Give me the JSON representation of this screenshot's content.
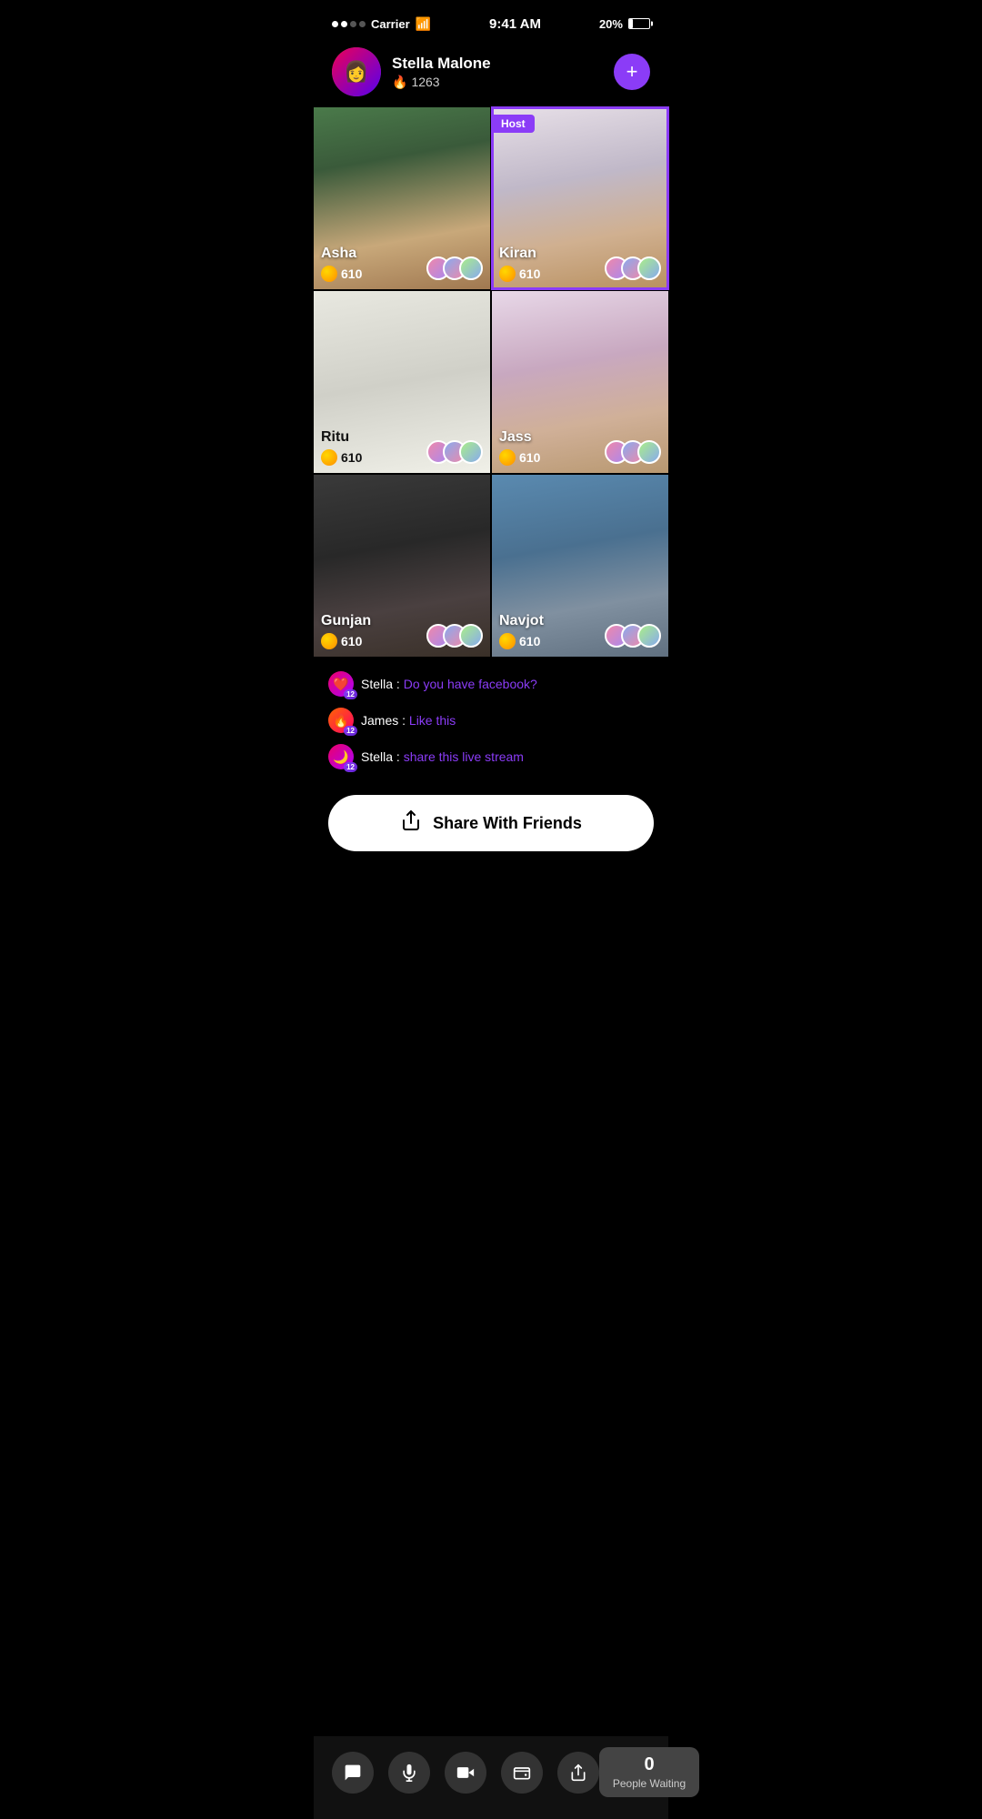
{
  "statusBar": {
    "carrier": "Carrier",
    "time": "9:41 AM",
    "battery": "20%"
  },
  "profile": {
    "name": "Stella Malone",
    "score": "1263",
    "addLabel": "+"
  },
  "grid": {
    "cells": [
      {
        "id": "asha",
        "name": "Asha",
        "coins": "610",
        "isHost": false,
        "bgClass": "bg-asha"
      },
      {
        "id": "kiran",
        "name": "Kiran",
        "coins": "610",
        "isHost": true,
        "bgClass": "bg-kiran"
      },
      {
        "id": "ritu",
        "name": "Ritu",
        "coins": "610",
        "isHost": false,
        "bgClass": "bg-ritu"
      },
      {
        "id": "jass",
        "name": "Jass",
        "coins": "610",
        "isHost": false,
        "bgClass": "bg-jass"
      },
      {
        "id": "gunjan",
        "name": "Gunjan",
        "coins": "610",
        "isHost": false,
        "bgClass": "bg-gunjan"
      },
      {
        "id": "navjot",
        "name": "Navjot",
        "coins": "610",
        "isHost": false,
        "bgClass": "bg-navjot"
      }
    ],
    "hostLabel": "Host"
  },
  "chat": {
    "messages": [
      {
        "id": "msg1",
        "user": "Stella",
        "separator": " : ",
        "content": "Do you have facebook?",
        "level": "12",
        "avatarClass": "chat-av-stella"
      },
      {
        "id": "msg2",
        "user": "James",
        "separator": " : ",
        "content": "Like this",
        "level": "12",
        "avatarClass": "chat-av-james"
      },
      {
        "id": "msg3",
        "user": "Stella",
        "separator": " : ",
        "content": "share this live stream",
        "level": "12",
        "avatarClass": "chat-av-stella"
      }
    ]
  },
  "shareButton": {
    "label": "Share With Friends"
  },
  "bottomBar": {
    "icons": [
      {
        "id": "chat-btn",
        "symbol": "💬"
      },
      {
        "id": "mic-btn",
        "symbol": "🎤"
      },
      {
        "id": "video-btn",
        "symbol": "🎥"
      },
      {
        "id": "wallet-btn",
        "symbol": "💳"
      },
      {
        "id": "share-btn",
        "symbol": "↗"
      }
    ],
    "peopleWaiting": {
      "count": "0",
      "label": "People Waiting"
    }
  }
}
